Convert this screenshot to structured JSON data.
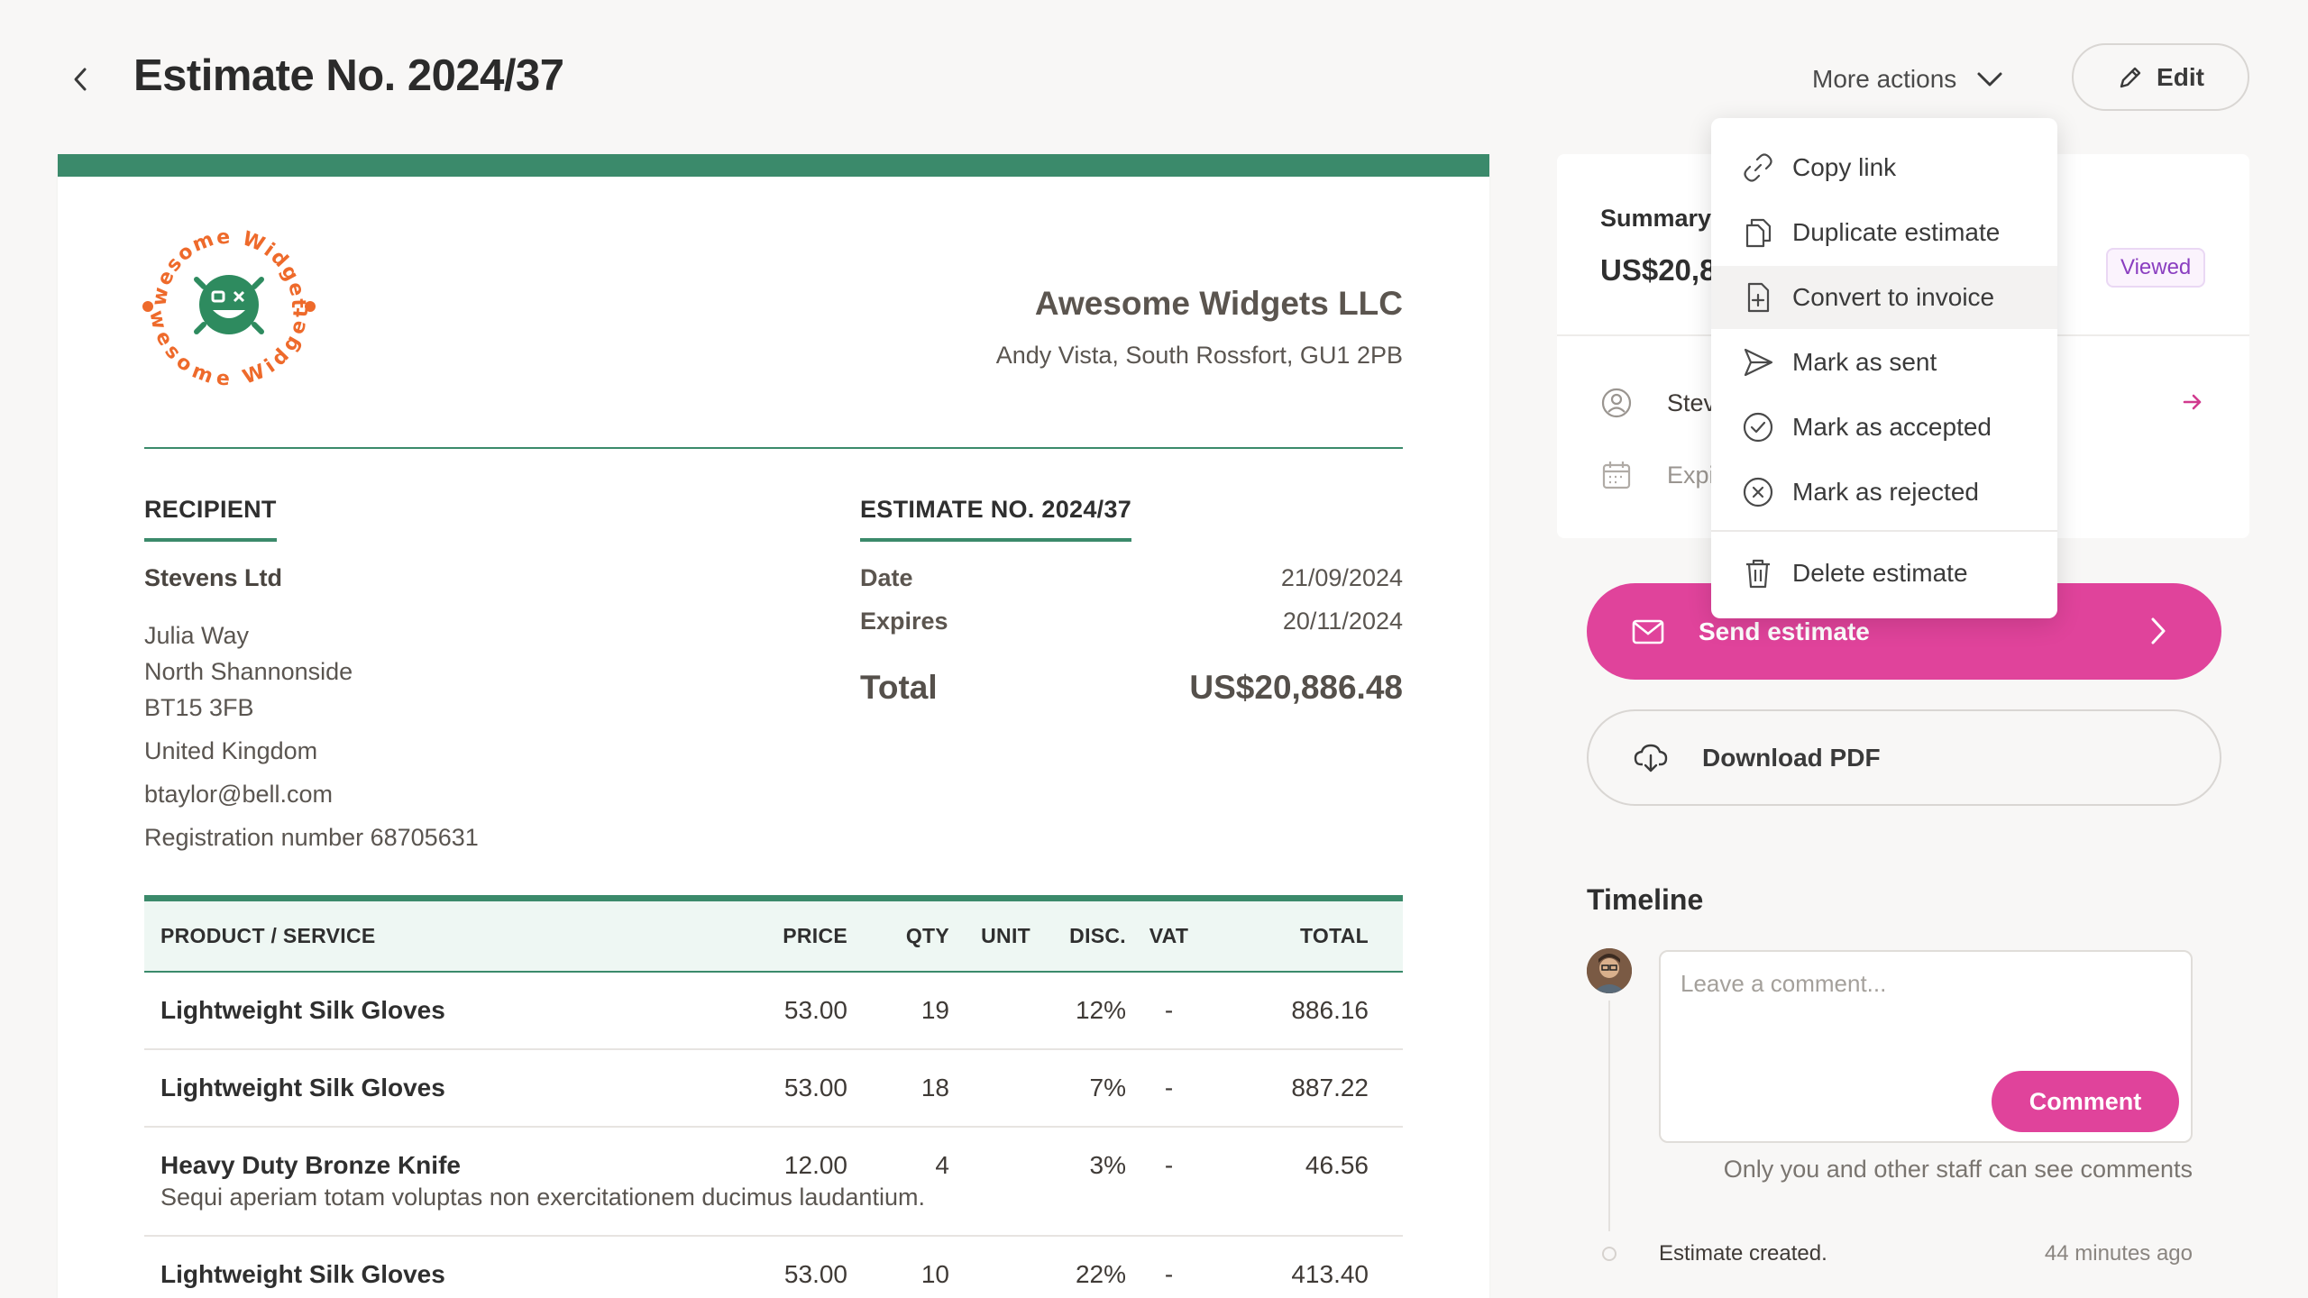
{
  "header": {
    "title": "Estimate No. 2024/37",
    "more_actions_label": "More actions",
    "edit_label": "Edit"
  },
  "logo": {
    "text_top": "Awesome Widgets",
    "text_bottom": "Awesome Widgets"
  },
  "company": {
    "name": "Awesome Widgets LLC",
    "address": "Andy Vista, South Rossfort, GU1 2PB"
  },
  "recipient": {
    "section_title": "RECIPIENT",
    "name": "Stevens Ltd",
    "address_line1": "Julia Way",
    "address_line2": "North Shannonside",
    "address_line3": "BT15 3FB",
    "country": "United Kingdom",
    "email": "btaylor@bell.com",
    "registration": "Registration number 68705631"
  },
  "estimate_meta": {
    "section_title": "ESTIMATE NO. 2024/37",
    "date_label": "Date",
    "date_value": "21/09/2024",
    "expires_label": "Expires",
    "expires_value": "20/11/2024",
    "total_label": "Total",
    "total_value": "US$20,886.48"
  },
  "table": {
    "headers": {
      "product": "PRODUCT / SERVICE",
      "price": "PRICE",
      "qty": "QTY",
      "unit": "UNIT",
      "disc": "DISC.",
      "vat": "VAT",
      "total": "TOTAL"
    },
    "rows": [
      {
        "name": "Lightweight Silk Gloves",
        "price": "53.00",
        "qty": "19",
        "unit": "",
        "disc": "12%",
        "vat": "-",
        "total": "886.16",
        "desc": ""
      },
      {
        "name": "Lightweight Silk Gloves",
        "price": "53.00",
        "qty": "18",
        "unit": "",
        "disc": "7%",
        "vat": "-",
        "total": "887.22",
        "desc": ""
      },
      {
        "name": "Heavy Duty Bronze Knife",
        "price": "12.00",
        "qty": "4",
        "unit": "",
        "disc": "3%",
        "vat": "-",
        "total": "46.56",
        "desc": "Sequi aperiam totam voluptas non exercitationem ducimus laudantium."
      },
      {
        "name": "Lightweight Silk Gloves",
        "price": "53.00",
        "qty": "10",
        "unit": "",
        "disc": "22%",
        "vat": "-",
        "total": "413.40",
        "desc": ""
      }
    ]
  },
  "summary": {
    "label": "Summary",
    "amount": "US$20,8",
    "status_badge": "Viewed",
    "client_partial": "Stev",
    "expires_partial": "Expi"
  },
  "actions": {
    "send_label": "Send estimate",
    "download_label": "Download PDF"
  },
  "menu": {
    "items": [
      {
        "label": "Copy link",
        "icon": "link-icon"
      },
      {
        "label": "Duplicate estimate",
        "icon": "copy-icon"
      },
      {
        "label": "Convert to invoice",
        "icon": "file-plus-icon"
      },
      {
        "label": "Mark as sent",
        "icon": "send-icon"
      },
      {
        "label": "Mark as accepted",
        "icon": "check-circle-icon"
      },
      {
        "label": "Mark as rejected",
        "icon": "x-circle-icon"
      },
      {
        "label": "Delete estimate",
        "icon": "trash-icon"
      }
    ]
  },
  "timeline": {
    "title": "Timeline",
    "comment_placeholder": "Leave a comment...",
    "comment_button": "Comment",
    "staff_note": "Only you and other staff can see comments",
    "events": [
      {
        "text": "Estimate created.",
        "time": "44 minutes ago"
      }
    ]
  },
  "colors": {
    "accent_green": "#3b8a6b",
    "accent_pink": "#e0439b",
    "logo_orange": "#ee6a2b",
    "badge_purple": "#8a3ec0"
  }
}
